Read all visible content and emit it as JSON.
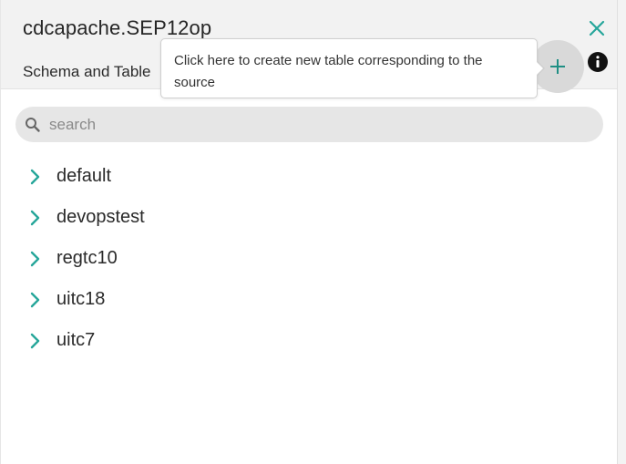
{
  "header": {
    "title": "cdcapache.SEP12op",
    "subtitle": "Schema and Table"
  },
  "tooltip": {
    "text": "Click here to create new table corresponding to the source"
  },
  "search": {
    "placeholder": "search",
    "value": ""
  },
  "tree": {
    "items": [
      {
        "label": "default"
      },
      {
        "label": "devopstest"
      },
      {
        "label": "regtc10"
      },
      {
        "label": "uitc18"
      },
      {
        "label": "uitc7"
      }
    ]
  },
  "icons": {
    "close": "close-icon",
    "add": "plus-icon",
    "info": "info-icon",
    "search": "search-icon",
    "expand": "chevron-right-icon"
  },
  "colors": {
    "accent": "#26a69a",
    "header_bg": "#f2f2f2",
    "search_bg": "#e6e6e6",
    "add_button_bg": "#d9d9d9"
  }
}
